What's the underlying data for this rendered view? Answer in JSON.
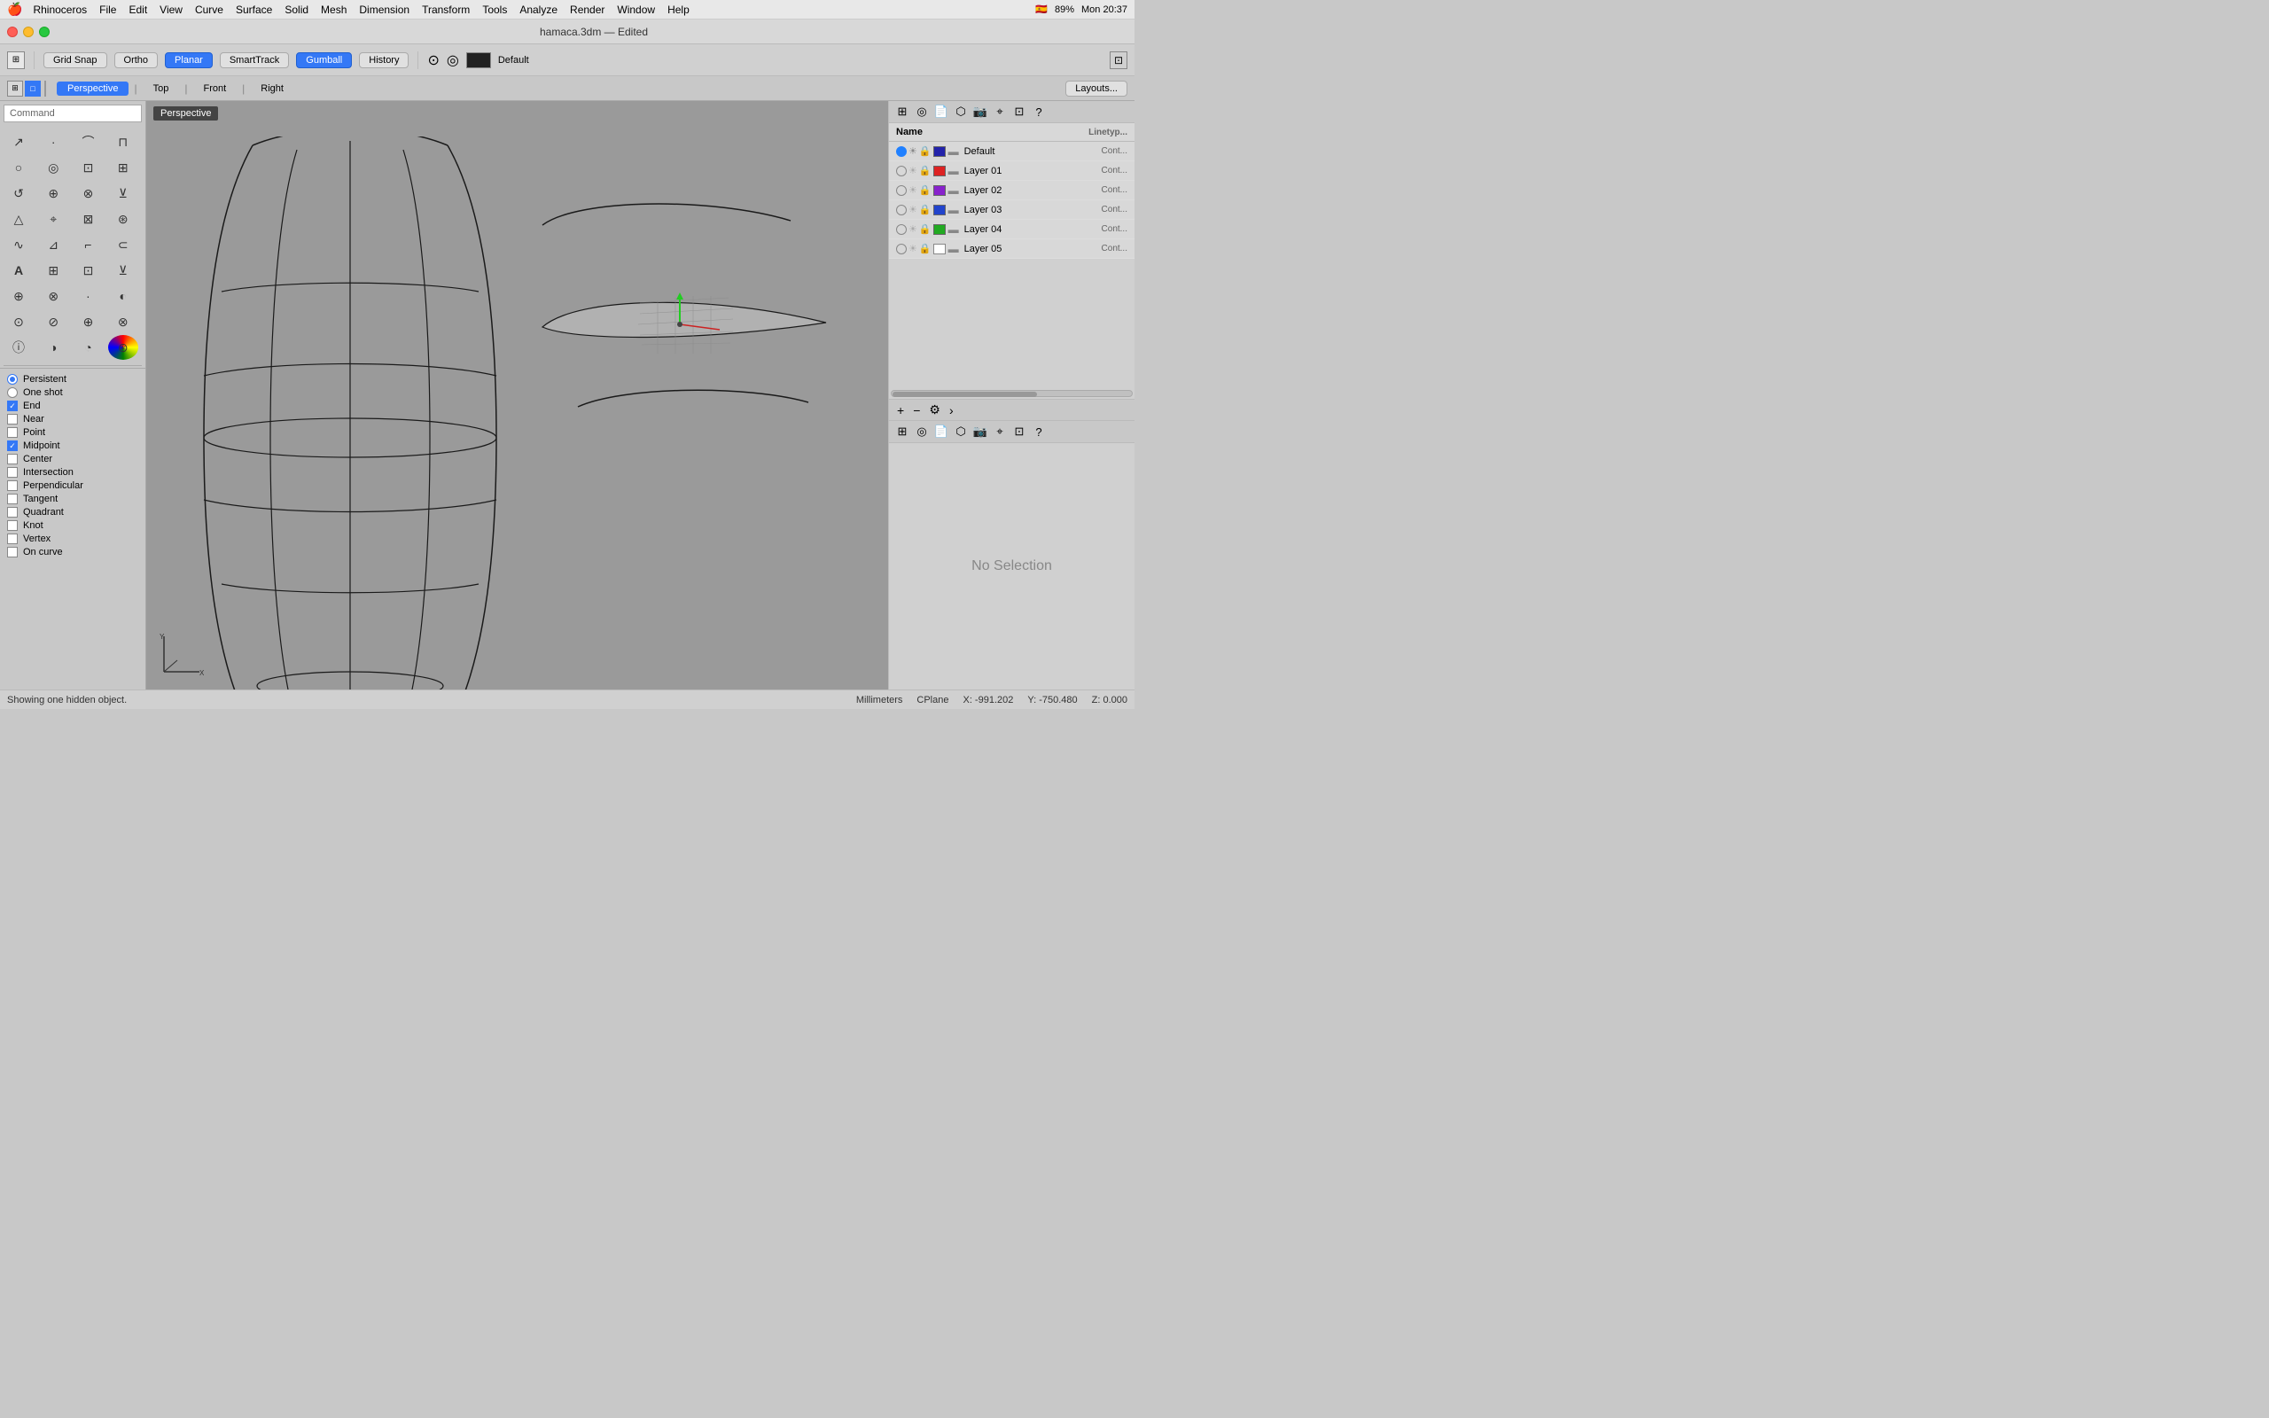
{
  "menubar": {
    "apple": "🍎",
    "items": [
      "Rhinoceros",
      "File",
      "Edit",
      "View",
      "Curve",
      "Surface",
      "Solid",
      "Mesh",
      "Dimension",
      "Transform",
      "Tools",
      "Analyze",
      "Render",
      "Window",
      "Help"
    ],
    "right": {
      "flag": "🇪🇸",
      "battery": "89%",
      "time": "Mon 20:37"
    }
  },
  "titlebar": {
    "title": "hamaca.3dm — Edited",
    "icon": "🐴"
  },
  "toolbar": {
    "grid_snap": "Grid Snap",
    "ortho": "Ortho",
    "planar": "Planar",
    "smart_track": "SmartTrack",
    "gumball": "Gumball",
    "history": "History",
    "color_label": "Default",
    "snap_target": "⊙",
    "circle_target": "◎"
  },
  "viewport_tabs": {
    "tabs": [
      "Perspective",
      "Top",
      "Front",
      "Right"
    ],
    "active": "Perspective",
    "layouts_btn": "Layouts..."
  },
  "command": {
    "placeholder": "Command",
    "value": ""
  },
  "snap_panel": {
    "items": [
      {
        "type": "radio",
        "label": "Persistent",
        "active": true
      },
      {
        "type": "radio",
        "label": "One shot",
        "active": false
      },
      {
        "type": "checkbox",
        "label": "End",
        "checked": true
      },
      {
        "type": "checkbox",
        "label": "Near",
        "checked": false
      },
      {
        "type": "checkbox",
        "label": "Point",
        "checked": false
      },
      {
        "type": "checkbox",
        "label": "Midpoint",
        "checked": true
      },
      {
        "type": "checkbox",
        "label": "Center",
        "checked": false
      },
      {
        "type": "checkbox",
        "label": "Intersection",
        "checked": false
      },
      {
        "type": "checkbox",
        "label": "Perpendicular",
        "checked": false
      },
      {
        "type": "checkbox",
        "label": "Tangent",
        "checked": false
      },
      {
        "type": "checkbox",
        "label": "Quadrant",
        "checked": false
      },
      {
        "type": "checkbox",
        "label": "Knot",
        "checked": false
      },
      {
        "type": "checkbox",
        "label": "Vertex",
        "checked": false
      },
      {
        "type": "checkbox",
        "label": "On curve",
        "checked": false
      }
    ]
  },
  "layers": {
    "header": {
      "name_col": "Name",
      "linetype_col": "Linetyp..."
    },
    "rows": [
      {
        "name": "Default",
        "active": true,
        "color": "#2222aa",
        "linetype": "Cont..."
      },
      {
        "name": "Layer 01",
        "active": false,
        "color": "#dd2222",
        "linetype": "Cont..."
      },
      {
        "name": "Layer 02",
        "active": false,
        "color": "#8822cc",
        "linetype": "Cont..."
      },
      {
        "name": "Layer 03",
        "active": false,
        "color": "#2244cc",
        "linetype": "Cont..."
      },
      {
        "name": "Layer 04",
        "active": false,
        "color": "#22aa22",
        "linetype": "Cont..."
      },
      {
        "name": "Layer 05",
        "active": false,
        "color": "#ffffff",
        "linetype": "Cont..."
      }
    ]
  },
  "viewport_label": "Perspective",
  "no_selection": "No Selection",
  "statusbar": {
    "message": "Showing one hidden object.",
    "units": "Millimeters",
    "cplane": "CPlane",
    "x": "X: -991.202",
    "y": "Y: -750.480",
    "z": "Z: 0.000"
  },
  "tools": {
    "icons": [
      "↗",
      "⊙",
      "⌒",
      "⊓",
      "○",
      "◎",
      "⌓",
      "⊡",
      "↺",
      "⌃",
      "⌐",
      "⊞",
      "△",
      "⬡",
      "⊕",
      "⊗",
      "∿",
      "⊿",
      "⌸",
      "⊠",
      "A",
      "⊞",
      "⊡",
      "⊻",
      "⊕",
      "⊗",
      "∙",
      "⊞",
      "⊙",
      "⊘",
      "⌖",
      "⊛"
    ]
  }
}
